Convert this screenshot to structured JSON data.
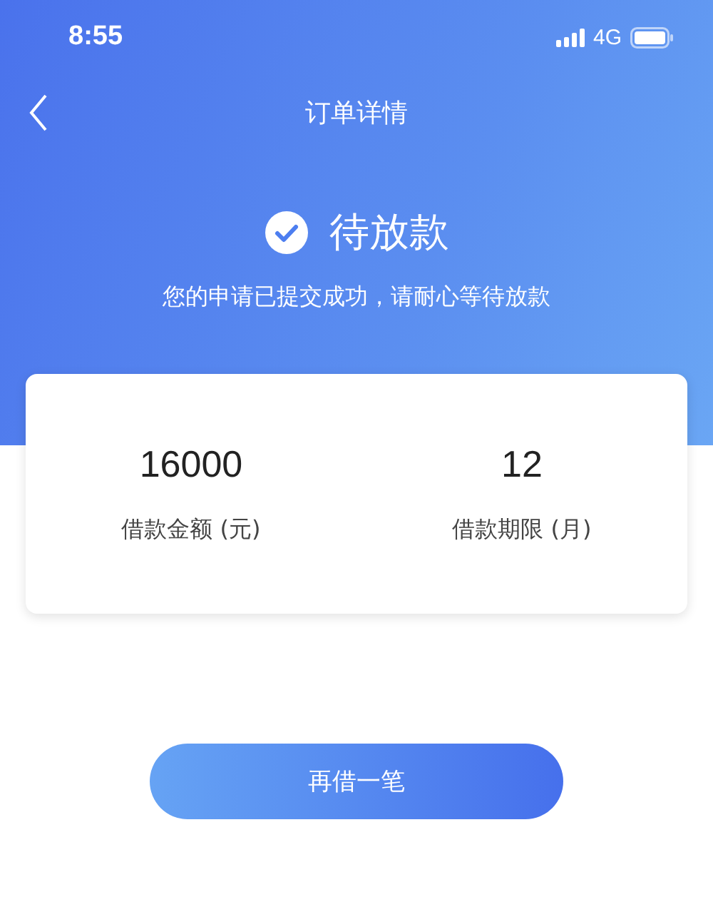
{
  "status_bar": {
    "time": "8:55",
    "network": "4G"
  },
  "nav": {
    "title": "订单详情"
  },
  "status": {
    "title": "待放款",
    "message": "您的申请已提交成功，请耐心等待放款"
  },
  "summary": [
    {
      "value": "16000",
      "label": "借款金额 (元)"
    },
    {
      "value": "12",
      "label": "借款期限 (月)"
    }
  ],
  "button": "再借一笔"
}
